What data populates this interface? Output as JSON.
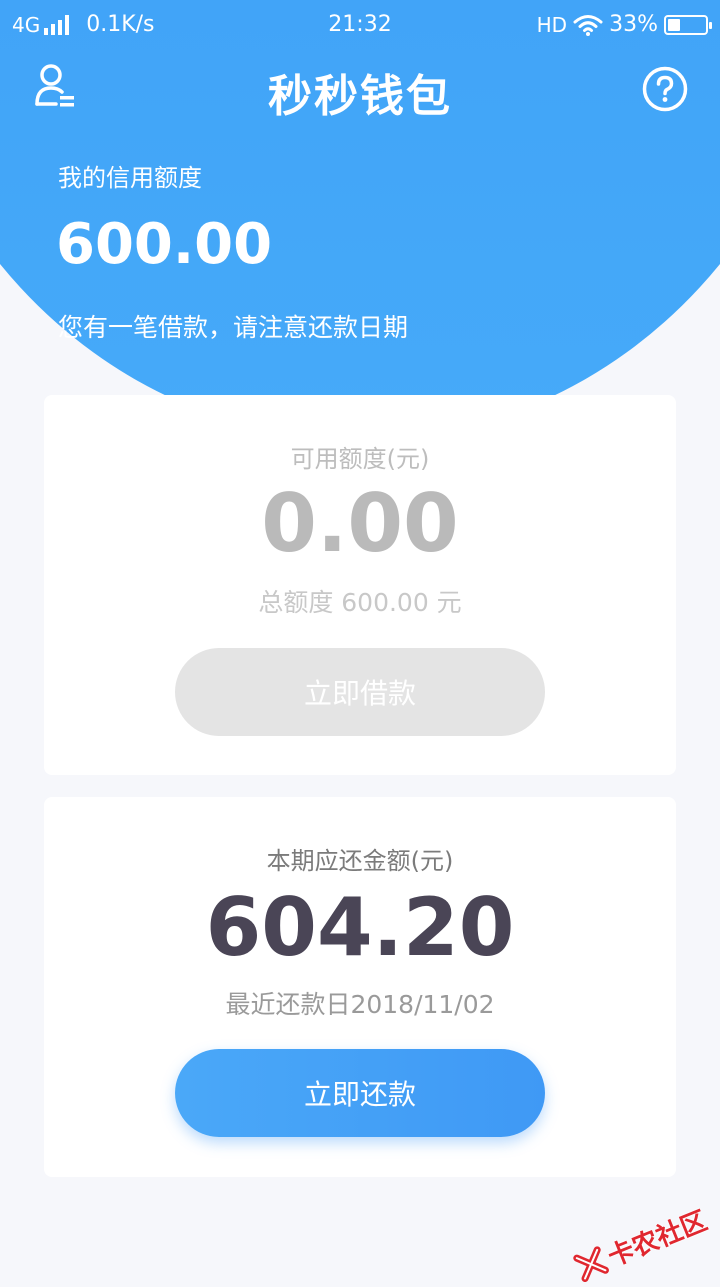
{
  "status_bar": {
    "network": "4G",
    "speed": "0.1K/s",
    "time": "21:32",
    "hd": "HD",
    "battery_text": "33%",
    "battery_level": 0.33
  },
  "nav": {
    "title": "秒秒钱包",
    "user_icon": "user-icon",
    "help_icon": "question-circle-icon"
  },
  "header": {
    "credit_label": "我的信用额度",
    "credit_value": "600.00",
    "notice": "您有一笔借款，请注意还款日期"
  },
  "available_card": {
    "label": "可用额度(元)",
    "amount": "0.00",
    "total": "总额度 600.00 元",
    "button_label": "立即借款"
  },
  "repay_card": {
    "label": "本期应还金额(元)",
    "amount": "604.20",
    "due_date": "最近还款日2018/11/02",
    "button_label": "立即还款"
  },
  "watermark": {
    "text": "卡农社区"
  },
  "colors": {
    "primary": "#3f99f5",
    "header_blue": "#3a9cf6",
    "disabled": "#e4e4e4",
    "amount_dark": "#4a4556",
    "background": "#f6f7fb",
    "watermark_red": "#e0272f"
  }
}
